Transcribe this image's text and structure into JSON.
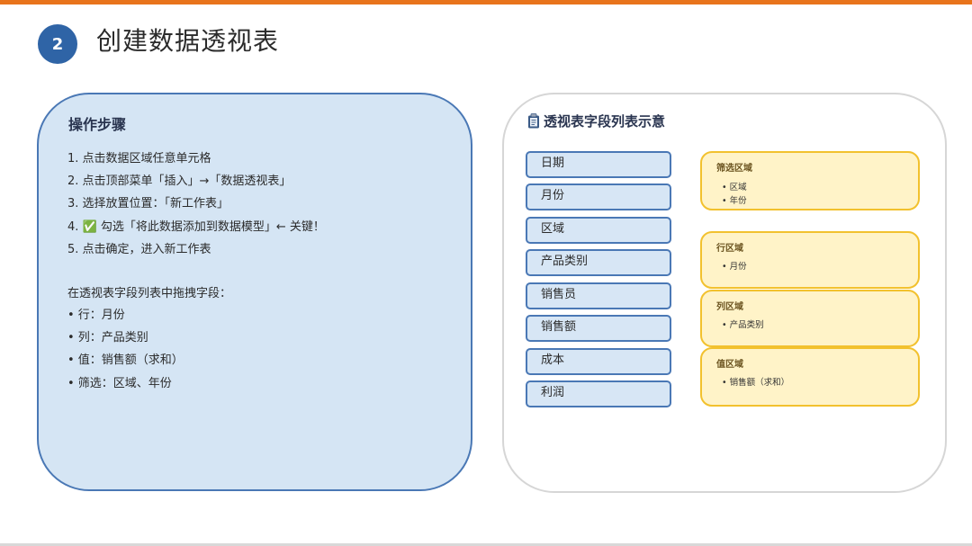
{
  "slide": {
    "step_number": "2",
    "title": "创建数据透视表"
  },
  "steps_panel": {
    "heading": "操作步骤",
    "steps": [
      "1. 点击数据区域任意单元格",
      "2. 点击顶部菜单「插入」→「数据透视表」",
      "3. 选择放置位置：「新工作表」",
      "4. ✅ 勾选「将此数据添加到数据模型」← 关键！",
      "5. 点击确定，进入新工作表"
    ],
    "drag_intro": "在透视表字段列表中拖拽字段：",
    "drag_items": [
      "• 行：月份",
      "• 列：产品类别",
      "• 值：销售额（求和）",
      "• 筛选：区域、年份"
    ]
  },
  "diagram": {
    "heading": "透视表字段列表示意",
    "heading_icon": "clipboard-icon",
    "fields": [
      "日期",
      "月份",
      "区域",
      "产品类别",
      "销售员",
      "销售额",
      "成本",
      "利润"
    ],
    "areas": [
      {
        "title": "筛选区域",
        "items": [
          "• 区域",
          "• 年份"
        ]
      },
      {
        "title": "行区域",
        "items": [
          "• 月份"
        ]
      },
      {
        "title": "列区域",
        "items": [
          "• 产品类别"
        ]
      },
      {
        "title": "值区域",
        "items": [
          "• 销售额（求和）"
        ]
      }
    ]
  },
  "colors": {
    "accent_bar": "#e8741c",
    "badge": "#2f64a6",
    "steps_panel_fill": "#d5e5f4",
    "field_fill": "#d7e6f5",
    "field_border": "#4a78b5",
    "area_fill": "#fff3c8",
    "area_border": "#f2c12e"
  }
}
